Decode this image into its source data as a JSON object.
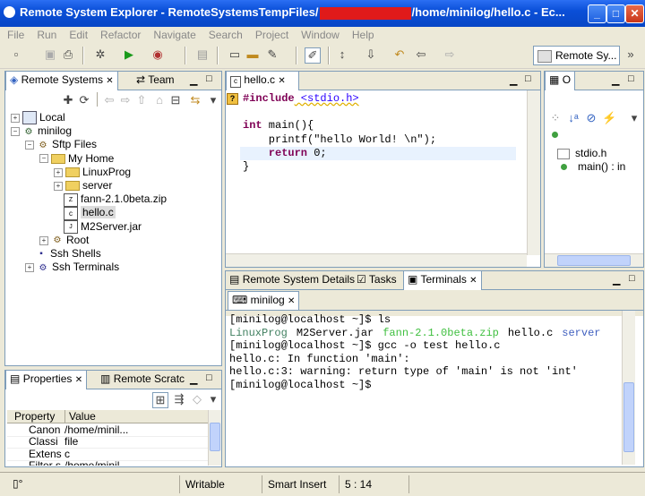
{
  "window": {
    "title_prefix": "Remote System Explorer - RemoteSystemsTempFiles/",
    "title_suffix": "/home/minilog/hello.c - Ec...",
    "min": "_",
    "max": "□",
    "close": "✕"
  },
  "menu": [
    "File",
    "Run",
    "Edit",
    "Refactor",
    "Navigate",
    "Search",
    "Project",
    "Window",
    "Help"
  ],
  "perspective": {
    "label": "Remote Sy..."
  },
  "remote_systems": {
    "tabs": [
      "Remote Systems",
      "Team"
    ],
    "tree": [
      {
        "label": "Local",
        "indent": 0,
        "exp": "+",
        "icon": "computer-icon"
      },
      {
        "label": "minilog",
        "indent": 0,
        "exp": "−",
        "icon": "host-icon"
      },
      {
        "label": "Sftp Files",
        "indent": 1,
        "exp": "−",
        "icon": "sftp-icon"
      },
      {
        "label": "My Home",
        "indent": 2,
        "exp": "−",
        "icon": "home-folder-icon"
      },
      {
        "label": "LinuxProg",
        "indent": 3,
        "exp": "+",
        "icon": "folder-icon"
      },
      {
        "label": "server",
        "indent": 3,
        "exp": "+",
        "icon": "folder-icon"
      },
      {
        "label": "fann-2.1.0beta.zip",
        "indent": 3,
        "exp": "",
        "icon": "zip-icon"
      },
      {
        "label": "hello.c",
        "indent": 3,
        "exp": "",
        "icon": "c-file-icon"
      },
      {
        "label": "M2Server.jar",
        "indent": 3,
        "exp": "",
        "icon": "jar-icon"
      },
      {
        "label": "Root",
        "indent": 2,
        "exp": "+",
        "icon": "root-icon"
      },
      {
        "label": "Ssh Shells",
        "indent": 1,
        "exp": "",
        "icon": "shell-icon"
      },
      {
        "label": "Ssh Terminals",
        "indent": 1,
        "exp": "+",
        "icon": "terminal-icon"
      }
    ]
  },
  "properties": {
    "tabs": [
      "Properties",
      "Remote Scratc"
    ],
    "col_property": "Property",
    "col_value": "Value",
    "rows": [
      {
        "p": "Canon",
        "v": "/home/minil..."
      },
      {
        "p": "Classi",
        "v": "file"
      },
      {
        "p": "Extens",
        "v": "c"
      },
      {
        "p": "Filter s",
        "v": "/home/minil"
      }
    ]
  },
  "editor": {
    "tab": "hello.c",
    "lines": [
      {
        "kw": "#include",
        "rest": " <stdio.h>"
      },
      {
        "kw": "",
        "rest": ""
      },
      {
        "kw": "int",
        "rest": " main(){"
      },
      {
        "kw": "",
        "rest": "    printf(\"hello World! \\n\");"
      },
      {
        "kw": "    return",
        "rest": " 0;"
      },
      {
        "kw": "",
        "rest": "}"
      }
    ]
  },
  "outline": {
    "tab": "O",
    "items": [
      "stdio.h",
      "main() : in"
    ]
  },
  "bottom": {
    "tabs": [
      "Remote System Details",
      "Tasks",
      "Terminals"
    ],
    "term_tab": "minilog",
    "lines": [
      "[minilog@localhost ~]$ ls",
      "",
      "[minilog@localhost ~]$ gcc -o test hello.c",
      "hello.c: In function 'main':",
      "hello.c:3: warning: return type of 'main' is not 'int'",
      "[minilog@localhost ~]$"
    ],
    "ls": [
      {
        "t": "LinuxProg",
        "c": "#3f7f5f"
      },
      {
        "t": "M2Server.jar",
        "c": "#000000"
      },
      {
        "t": "fann-2.1.0beta.zip",
        "c": "#3fbf3f"
      },
      {
        "t": "hello.c",
        "c": "#000000"
      },
      {
        "t": "server",
        "c": "#3f5fbf"
      }
    ]
  },
  "status": {
    "writable": "Writable",
    "insert": "Smart Insert",
    "pos": "5 : 14"
  }
}
